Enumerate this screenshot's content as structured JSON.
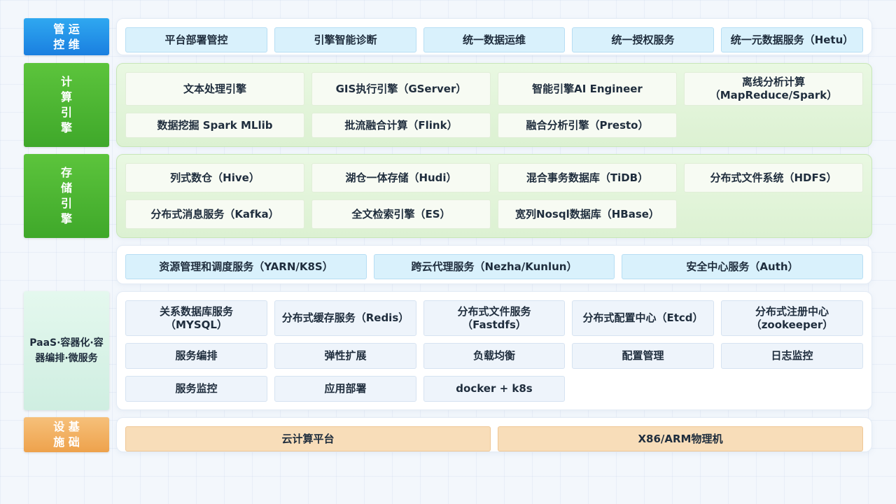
{
  "layers": {
    "ops": {
      "label": [
        "管 运",
        "控 维"
      ],
      "items": [
        "平台部署管控",
        "引擎智能诊断",
        "统一数据运维",
        "统一授权服务",
        "统一元数据服务（Hetu）"
      ]
    },
    "compute": {
      "label": [
        "计",
        "算",
        "引",
        "擎"
      ],
      "items": [
        "文本处理引擎",
        "GIS执行引擎（GServer）",
        "智能引擎AI Engineer",
        "离线分析计算\n（MapReduce/Spark）",
        "数据挖掘 Spark MLlib",
        "批流融合计算（Flink）",
        "融合分析引擎（Presto）"
      ]
    },
    "storage": {
      "label": [
        "存",
        "储",
        "引",
        "擎"
      ],
      "items": [
        "列式数仓（Hive）",
        "湖仓一体存储（Hudi）",
        "混合事务数据库（TiDB）",
        "分布式文件系统（HDFS）",
        "分布式消息服务（Kafka）",
        "全文检索引擎（ES）",
        "宽列Nosql数据库（HBase）"
      ]
    },
    "services": {
      "items": [
        "资源管理和调度服务（YARN/K8S）",
        "跨云代理服务（Nezha/Kunlun）",
        "安全中心服务（Auth）"
      ]
    },
    "paas": {
      "label": [
        "PaaS·容器化·容",
        "器编排·微服务"
      ],
      "items": [
        "关系数据库服务\n（MYSQL）",
        "分布式缓存服务（Redis）",
        "分布式文件服务\n（Fastdfs）",
        "分布式配置中心（Etcd）",
        "分布式注册中心\n（zookeeper）",
        "服务编排",
        "弹性扩展",
        "负载均衡",
        "配置管理",
        "日志监控",
        "服务监控",
        "应用部署",
        "docker + k8s"
      ]
    },
    "infra": {
      "label": [
        "设 基",
        "施 础"
      ],
      "items": [
        "云计算平台",
        "X86/ARM物理机"
      ]
    }
  },
  "colors": {
    "ops_label": "#1f8ee6",
    "engine_label": "#4cb833",
    "paas_label": "#d8f3e7",
    "infra_label": "#f0ac5c",
    "blue_box": "#d9f1fc",
    "orange_box": "#f8ddb9"
  }
}
